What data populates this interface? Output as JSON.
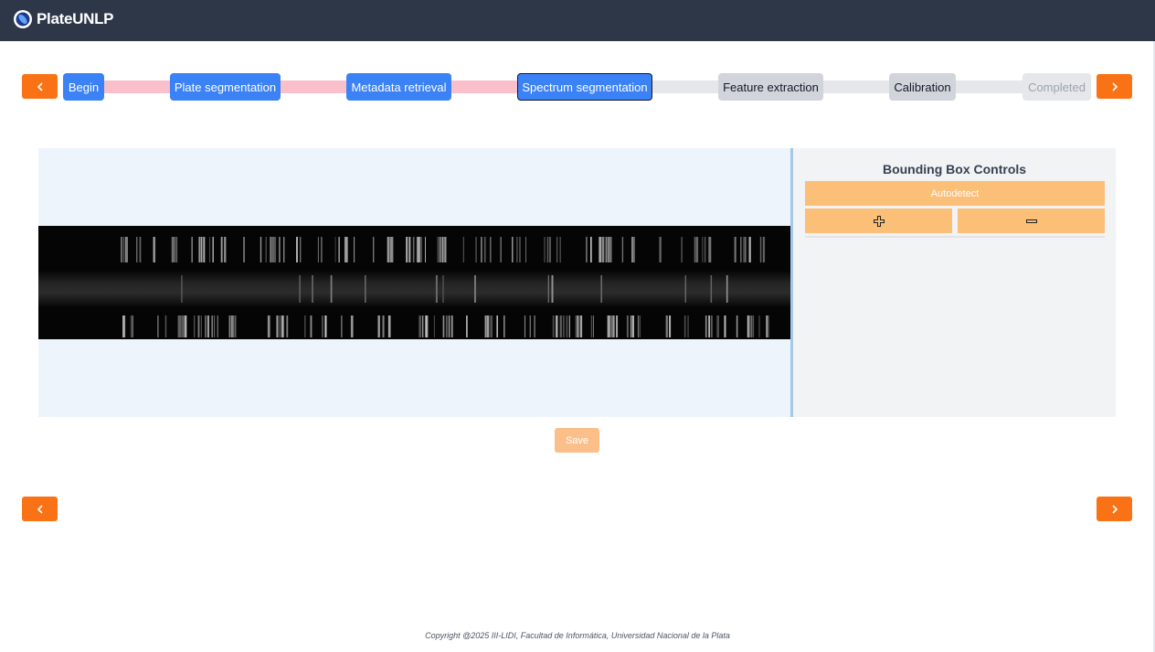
{
  "app": {
    "brand": "PlateUNLP"
  },
  "stepper": {
    "prev_icon": "chevron-left-icon",
    "next_icon": "chevron-right-icon",
    "steps": [
      {
        "label": "Begin",
        "state": "done"
      },
      {
        "label": "Plate segmentation",
        "state": "done"
      },
      {
        "label": "Metadata retrieval",
        "state": "done"
      },
      {
        "label": "Spectrum segmentation",
        "state": "active"
      },
      {
        "label": "Feature extraction",
        "state": "pending"
      },
      {
        "label": "Calibration",
        "state": "pending"
      },
      {
        "label": "Completed",
        "state": "disabled"
      }
    ]
  },
  "controls": {
    "title": "Bounding Box Controls",
    "autodetect_label": "Autodetect",
    "add_icon": "plus-icon",
    "remove_icon": "minus-icon"
  },
  "save_label": "Save",
  "footer": "Copyright @2025 III-LIDI, Facultad de Informática, Universidad Nacional de la Plata",
  "colors": {
    "header": "#2d3748",
    "nav_button": "#f97316",
    "step_done": "#3b82f6",
    "track_done": "#f9c0cb",
    "track_pending": "#e5e7eb",
    "control_button": "#fbbf78",
    "viewer_bg": "#eef4fc"
  }
}
